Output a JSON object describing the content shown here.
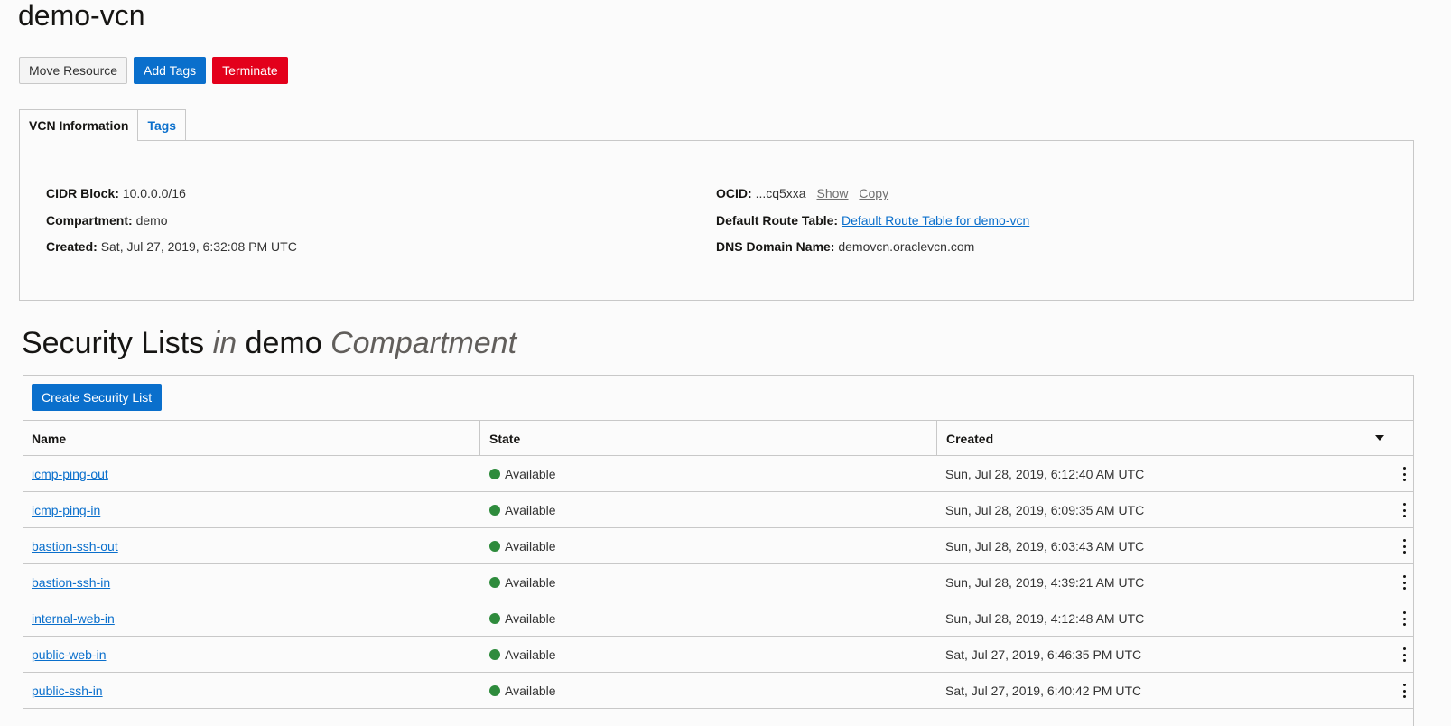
{
  "page": {
    "title": "demo-vcn"
  },
  "actions": {
    "move_resource": "Move Resource",
    "add_tags": "Add Tags",
    "terminate": "Terminate"
  },
  "tabs": [
    {
      "label": "VCN Information",
      "active": true
    },
    {
      "label": "Tags",
      "active": false
    }
  ],
  "info": {
    "cidr_label": "CIDR Block:",
    "cidr_value": "10.0.0.0/16",
    "compartment_label": "Compartment:",
    "compartment_value": "demo",
    "created_label": "Created:",
    "created_value": "Sat, Jul 27, 2019, 6:32:08 PM UTC",
    "ocid_label": "OCID:",
    "ocid_value": "...cq5xxa",
    "ocid_show": "Show",
    "ocid_copy": "Copy",
    "route_label": "Default Route Table:",
    "route_value": "Default Route Table for demo-vcn",
    "dns_label": "DNS Domain Name:",
    "dns_value": "demovcn.oraclevcn.com"
  },
  "section": {
    "title_1": "Security Lists",
    "title_in": "in",
    "title_2": "demo",
    "title_3": "Compartment"
  },
  "table": {
    "create_label": "Create Security List",
    "headers": {
      "name": "Name",
      "state": "State",
      "created": "Created"
    },
    "rows": [
      {
        "name": "icmp-ping-out",
        "state": "Available",
        "created": "Sun, Jul 28, 2019, 6:12:40 AM UTC"
      },
      {
        "name": "icmp-ping-in",
        "state": "Available",
        "created": "Sun, Jul 28, 2019, 6:09:35 AM UTC"
      },
      {
        "name": "bastion-ssh-out",
        "state": "Available",
        "created": "Sun, Jul 28, 2019, 6:03:43 AM UTC"
      },
      {
        "name": "bastion-ssh-in",
        "state": "Available",
        "created": "Sun, Jul 28, 2019, 4:39:21 AM UTC"
      },
      {
        "name": "internal-web-in",
        "state": "Available",
        "created": "Sun, Jul 28, 2019, 4:12:48 AM UTC"
      },
      {
        "name": "public-web-in",
        "state": "Available",
        "created": "Sat, Jul 27, 2019, 6:46:35 PM UTC"
      },
      {
        "name": "public-ssh-in",
        "state": "Available",
        "created": "Sat, Jul 27, 2019, 6:40:42 PM UTC"
      }
    ]
  },
  "colors": {
    "primary": "#0a6fcc",
    "danger": "#e3001b",
    "available": "#2e8b3c"
  },
  "icons": {
    "sort": "caret-down-icon",
    "row_menu": "kebab-menu-icon",
    "status": "status-dot-icon"
  }
}
